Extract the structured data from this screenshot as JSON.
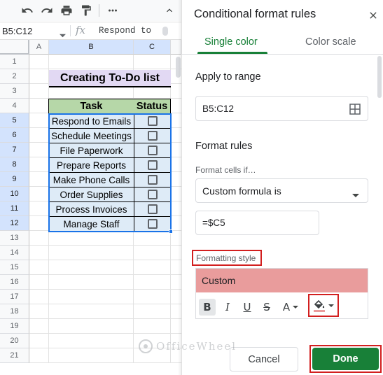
{
  "sheet": {
    "name_box": "B5:C12",
    "fx_symbol": "fx",
    "formula_text": "Respond to",
    "columns": [
      "A",
      "B",
      "C"
    ],
    "rows": [
      "1",
      "2",
      "3",
      "4",
      "5",
      "6",
      "7",
      "8",
      "9",
      "10",
      "11",
      "12",
      "13",
      "14",
      "15",
      "16",
      "17",
      "18",
      "19",
      "20",
      "21"
    ],
    "title": "Creating To-Do list",
    "headers": {
      "task": "Task",
      "status": "Status"
    },
    "tasks": [
      "Respond to Emails",
      "Schedule Meetings",
      "File Paperwork",
      "Prepare Reports",
      "Make Phone Calls",
      "Order Supplies",
      "Process Invoices",
      "Manage Staff"
    ],
    "status_checked": [
      false,
      false,
      false,
      false,
      false,
      false,
      false,
      false
    ]
  },
  "panel": {
    "title": "Conditional format rules",
    "tabs": [
      {
        "label": "Single color",
        "selected": true
      },
      {
        "label": "Color scale",
        "selected": false
      }
    ],
    "apply_to_range_label": "Apply to range",
    "range_value": "B5:C12",
    "format_rules_label": "Format rules",
    "format_cells_if_label": "Format cells if…",
    "condition_value": "Custom formula is",
    "formula_value": "=$C5",
    "formatting_style_label": "Formatting style",
    "style_preview_text": "Custom",
    "style_fill_color": "#e99c9c",
    "format_buttons": {
      "bold": "B",
      "italic": "I",
      "underline": "U",
      "strikethrough": "S",
      "text_color": "A"
    },
    "cancel_label": "Cancel",
    "done_label": "Done"
  },
  "colors": {
    "accent_green": "#188038",
    "highlight_red": "#d21f1f",
    "title_fill": "#e2d9f3",
    "header_fill": "#b6d7a8",
    "task_fill": "#deebf7",
    "selection_blue": "#1a73e8"
  },
  "watermark": "OfficeWheel",
  "icons": [
    "undo-icon",
    "redo-icon",
    "print-icon",
    "paint-format-icon",
    "more-icon",
    "collapse-icon",
    "close-icon",
    "grid-icon",
    "chevron-down-icon",
    "fill-color-icon",
    "officewheel-logo-icon"
  ]
}
